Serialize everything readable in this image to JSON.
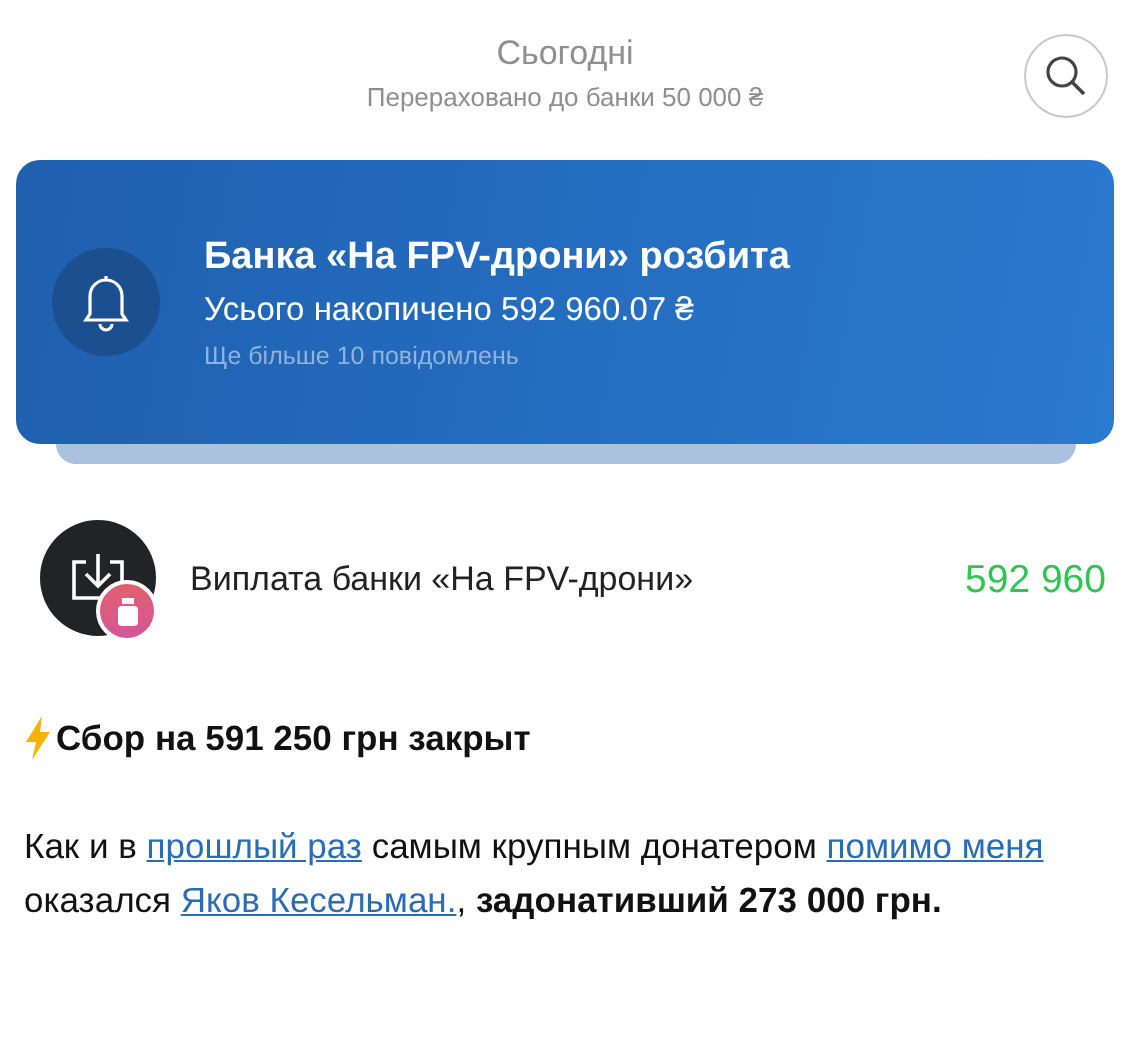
{
  "header": {
    "title": "Сьогодні",
    "subtitle": "Перераховано до банки 50 000 ₴"
  },
  "notification": {
    "title": "Банка «На FPV-дрони» розбита",
    "body": "Усього накопичено 592 960.07 ₴",
    "more": "Ще більше 10 повідомлень"
  },
  "transaction": {
    "label": "Виплата банки «На FPV-дрони»",
    "amount": "592 960"
  },
  "post": {
    "headline": "Сбор на 591 250 грн закрыт",
    "paragraph": [
      {
        "kind": "text",
        "text": "Как и в "
      },
      {
        "kind": "link",
        "text": "прошлый раз"
      },
      {
        "kind": "text",
        "text": " самым крупным донатером "
      },
      {
        "kind": "link",
        "text": "помимо меня"
      },
      {
        "kind": "text",
        "text": " оказался "
      },
      {
        "kind": "link",
        "text": "Яков Кесельман."
      },
      {
        "kind": "text",
        "text": ", **задонативший 273 000 грн.**"
      }
    ]
  }
}
